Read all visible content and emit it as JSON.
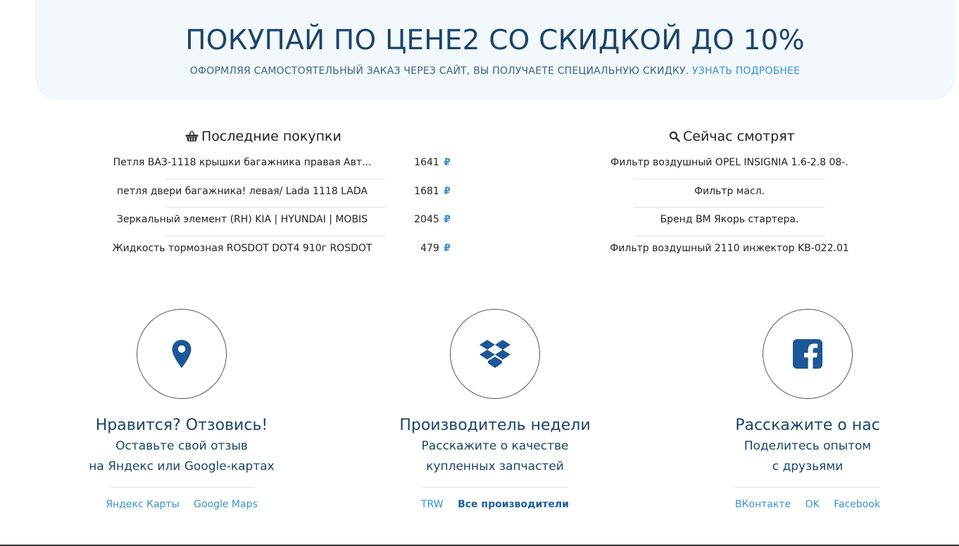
{
  "promo": {
    "title": "ПОКУПАЙ ПО ЦЕНЕ2 СО СКИДКОЙ ДО 10%",
    "subtitle": "ОФОРМЛЯЯ САМОСТОЯТЕЛЬНЫЙ ЗАКАЗ ЧЕРЕЗ САЙТ, ВЫ ПОЛУЧАЕТЕ СПЕЦИАЛЬНУЮ СКИДКУ.",
    "link": "УЗНАТЬ ПОДРОБНЕЕ"
  },
  "purchases": {
    "title": "Последние покупки",
    "icon": "basket-icon",
    "currency": "₽",
    "items": [
      {
        "name": "Петля ВАЗ-1118 крышки багажника правая Авт...",
        "price": "1641"
      },
      {
        "name": "петля двери багажника! левая/ Lada 1118 LADA",
        "price": "1681"
      },
      {
        "name": "Зеркальный элемент (RH) KIA | HYUNDAI | MOBIS",
        "price": "2045"
      },
      {
        "name": "Жидкость тормозная ROSDOT DOT4 910г ROSDOT",
        "price": "479"
      }
    ]
  },
  "watching": {
    "title": "Сейчас смотрят",
    "icon": "search-icon",
    "items": [
      "Фильтр воздушный OPEL INSIGNIA 1.6-2.8 08-.",
      "Фильтр масл.",
      "Бренд BM Якорь стартера.",
      "Фильтр воздушный 2110 инжектор KB-022.01"
    ]
  },
  "features": [
    {
      "icon": "map-marker-icon",
      "title": "Нравится? Отзовись!",
      "line1": "Оставьте свой отзыв",
      "line2": "на Яндекс или Google-картах",
      "links": [
        "Яндекс Карты",
        "Google Maps"
      ]
    },
    {
      "icon": "dropbox-icon",
      "title": "Производитель недели",
      "line1": "Расскажите о качестве",
      "line2": "купленных запчастей",
      "links": [
        "TRW",
        "Все производители"
      ]
    },
    {
      "icon": "facebook-icon",
      "title": "Расскажите о нас",
      "line1": "Поделитесь опытом",
      "line2": "с друзьями",
      "links": [
        "ВКонтакте",
        "OK",
        "Facebook"
      ]
    }
  ],
  "colors": {
    "accent": "#3a8fd0",
    "dark_blue": "#1c4469",
    "banner_bg": "#f3f8fd"
  }
}
